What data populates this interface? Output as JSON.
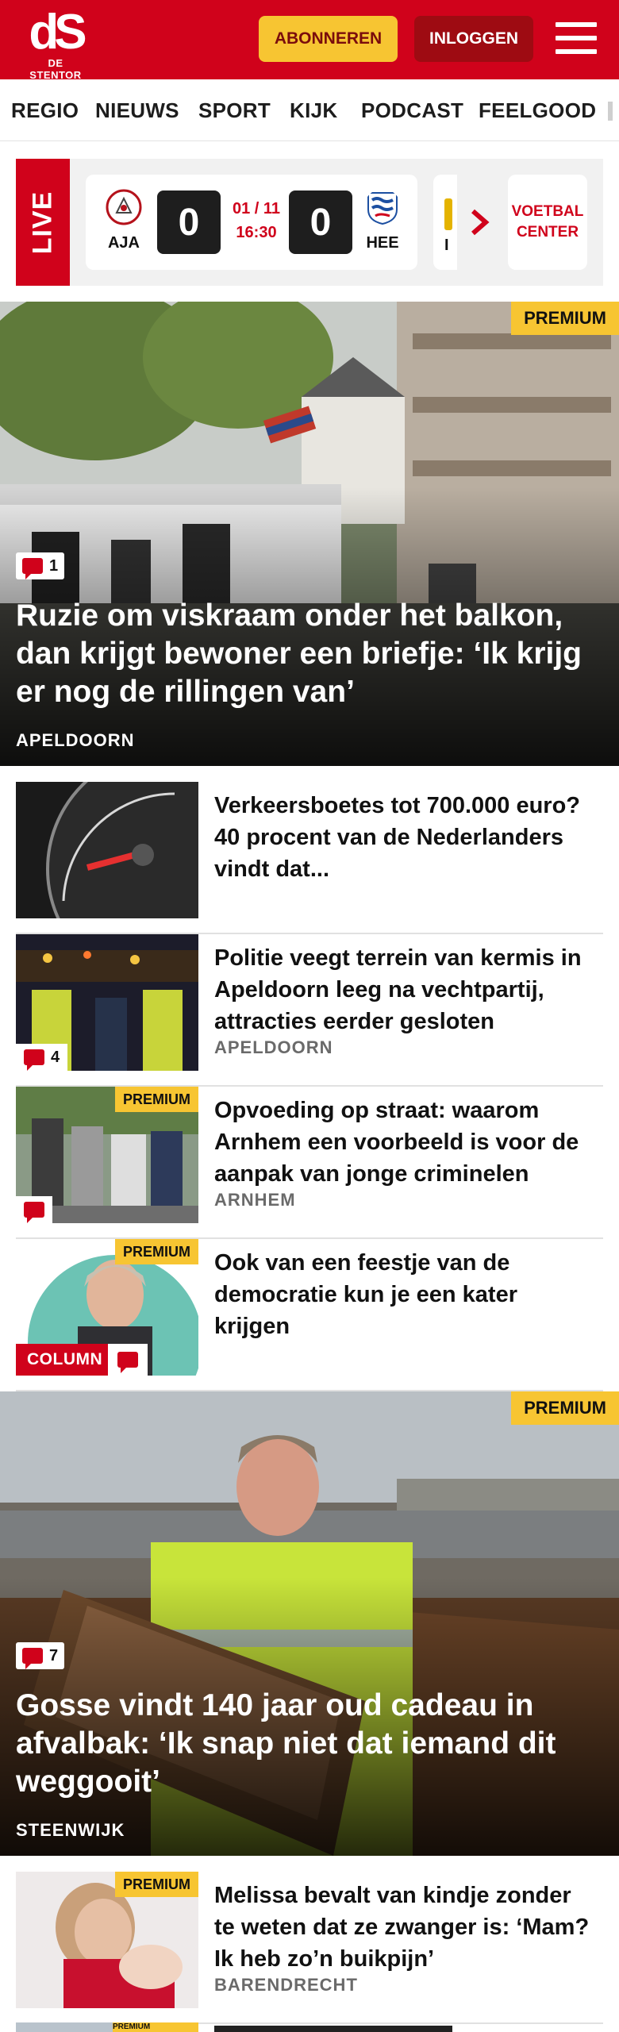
{
  "header": {
    "logo_mark": "dS",
    "logo_brand": "DE STENTOR",
    "subscribe_label": "ABONNEREN",
    "login_label": "INLOGGEN",
    "brand_color": "#d0021b",
    "accent_color": "#f7c532"
  },
  "nav": {
    "items": [
      {
        "label": "REGIO"
      },
      {
        "label": "NIEUWS"
      },
      {
        "label": "SPORT"
      },
      {
        "label": "KIJK"
      },
      {
        "label": "PODCAST"
      },
      {
        "label": "FEELGOOD"
      }
    ]
  },
  "live": {
    "label": "LIVE",
    "match": {
      "home": "AJA",
      "away": "HEE",
      "home_score": "0",
      "away_score": "0",
      "date": "01 / 11",
      "time": "16:30"
    },
    "next_match_partial": "I",
    "voetbal_center_line1": "VOETBAL",
    "voetbal_center_line2": "CENTER"
  },
  "articles": {
    "hero1": {
      "premium": "PREMIUM",
      "comments": "1",
      "title": "Ruzie om viskraam onder het balkon, dan krijgt bewoner een briefje: ‘Ik krijg er nog de rillingen van’",
      "location": "APELDOORN"
    },
    "list1": [
      {
        "title": "Verkeersboetes tot 700.000 euro? 40 procent van de Nederlanders vindt dat...",
        "location": ""
      },
      {
        "title": "Politie veegt terrein van kermis in Apeldoorn leeg na vechtpartij, attracties eerder gesloten",
        "location": "APELDOORN",
        "comments": "4"
      },
      {
        "title": "Opvoeding op straat: waarom Arnhem een voorbeeld is voor de aanpak van jonge criminelen",
        "location": "ARNHEM",
        "premium": "PREMIUM"
      },
      {
        "title": "Ook van een feestje van de democratie kun je een kater krijgen",
        "premium": "PREMIUM",
        "tag": "COLUMN"
      }
    ],
    "hero2": {
      "premium": "PREMIUM",
      "comments": "7",
      "title": "Gosse vindt 140 jaar oud cadeau in afvalbak: ‘Ik snap niet dat iemand dit weggooit’",
      "location": "STEENWIJK"
    },
    "list2": [
      {
        "title": "Melissa bevalt van kindje zonder te weten dat ze zwanger is: ‘Mam? Ik heb zo’n buikpijn’",
        "location": "BARENDRECHT",
        "premium": "PREMIUM"
      }
    ],
    "partial_next": {
      "premium": "PREMIUM"
    }
  }
}
